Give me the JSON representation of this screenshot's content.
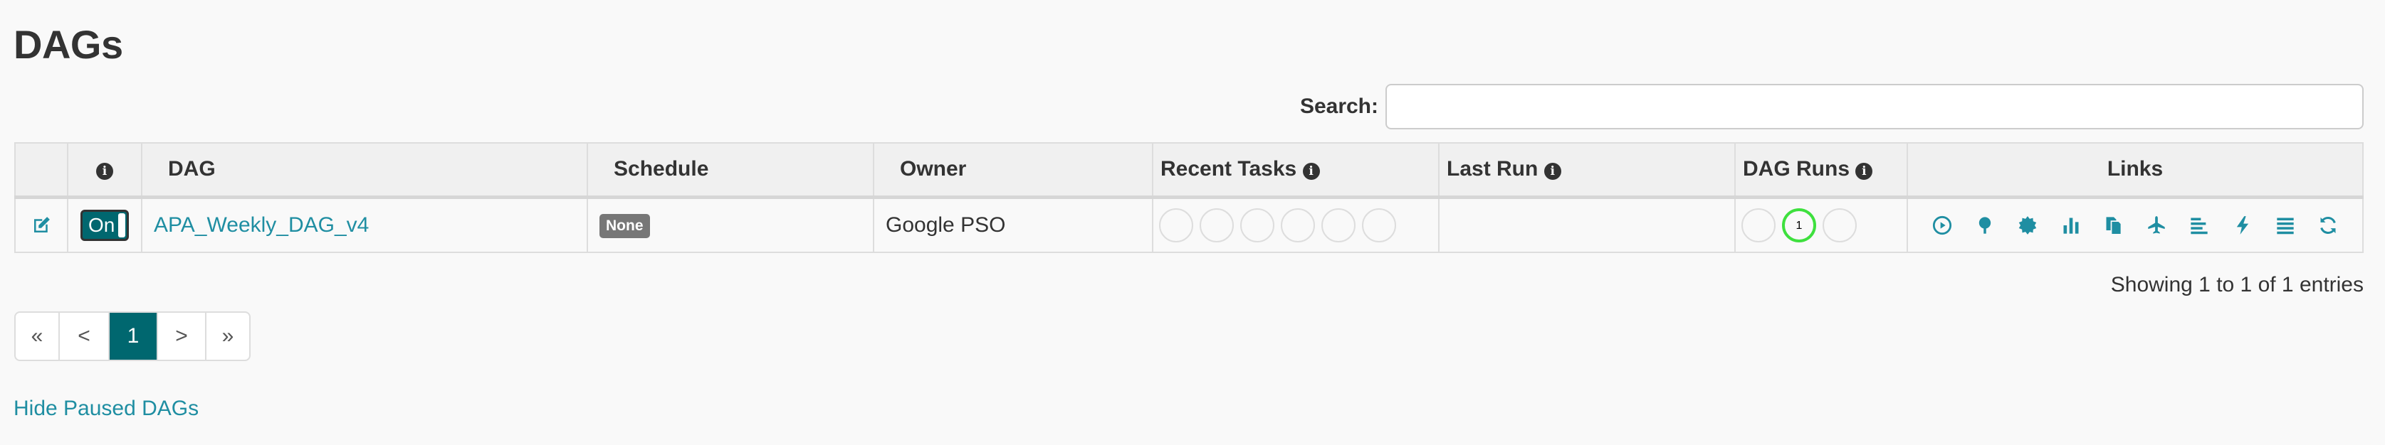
{
  "page": {
    "title": "DAGs"
  },
  "search": {
    "label": "Search:",
    "value": "",
    "placeholder": ""
  },
  "table": {
    "headers": {
      "info": "i",
      "dag": "DAG",
      "schedule": "Schedule",
      "owner": "Owner",
      "recent_tasks": "Recent Tasks",
      "last_run": "Last Run",
      "dag_runs": "DAG Runs",
      "links": "Links"
    },
    "rows": [
      {
        "toggle": "On",
        "dag_id": "APA_Weekly_DAG_v4",
        "schedule": "None",
        "owner": "Google PSO",
        "last_run": "",
        "dag_runs_success_count": "1"
      }
    ]
  },
  "link_icons": [
    "trigger-dag",
    "tree-view",
    "graph-view",
    "task-duration",
    "task-tries",
    "landing-times",
    "gantt",
    "code",
    "logs",
    "refresh"
  ],
  "footer": {
    "showing": "Showing 1 to 1 of 1 entries",
    "pager": {
      "first": "«",
      "prev": "<",
      "current": "1",
      "next": ">",
      "last": "»"
    },
    "hide_paused": "Hide Paused DAGs"
  },
  "colors": {
    "accent": "#00676f",
    "link": "#1f8ea2",
    "success": "#3ee03e"
  }
}
